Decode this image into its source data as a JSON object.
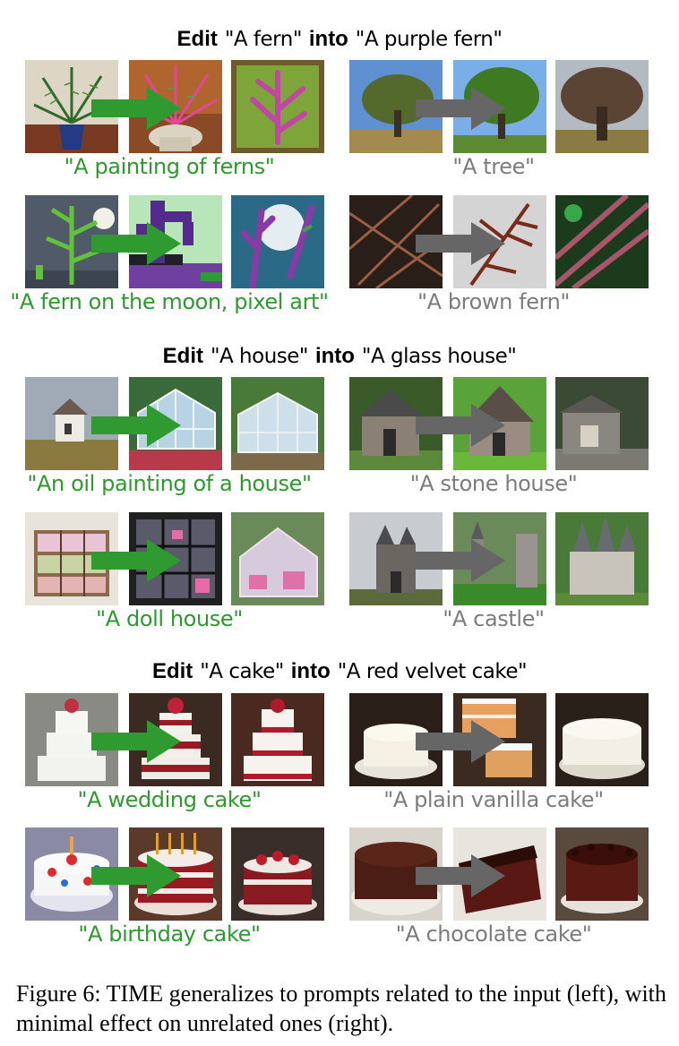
{
  "sections": [
    {
      "edit_word": "Edit",
      "source_prompt": "\"A fern\"",
      "into_word": "into",
      "target_prompt": "\"A purple fern\"",
      "left": [
        {
          "caption": "\"A painting of ferns\""
        },
        {
          "caption": "\"A fern on the moon, pixel art\""
        }
      ],
      "right": [
        {
          "caption": "\"A tree\""
        },
        {
          "caption": "\"A brown fern\""
        }
      ]
    },
    {
      "edit_word": "Edit",
      "source_prompt": "\"A house\"",
      "into_word": "into",
      "target_prompt": "\"A glass house\"",
      "left": [
        {
          "caption": "\"An oil painting of a house\""
        },
        {
          "caption": "\"A doll house\""
        }
      ],
      "right": [
        {
          "caption": "\"A stone house\""
        },
        {
          "caption": "\"A castle\""
        }
      ]
    },
    {
      "edit_word": "Edit",
      "source_prompt": "\"A cake\"",
      "into_word": "into",
      "target_prompt": "\"A red velvet cake\"",
      "left": [
        {
          "caption": "\"A wedding cake\""
        },
        {
          "caption": "\"A birthday cake\""
        }
      ],
      "right": [
        {
          "caption": "\"A plain vanilla cake\""
        },
        {
          "caption": "\"A chocolate cake\""
        }
      ]
    }
  ],
  "colors": {
    "related_caption": "#2e9a2e",
    "unrelated_caption": "#7c7c7c",
    "related_arrow": "#2f9a2f",
    "unrelated_arrow": "#666666"
  },
  "figure_caption": "Figure 6: TIME generalizes to prompts related to the input (left), with minimal effect on unrelated ones (right)."
}
